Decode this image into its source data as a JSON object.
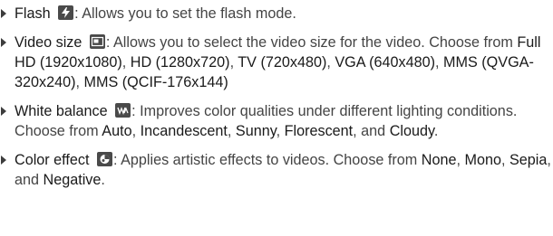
{
  "items": [
    {
      "term": "Flash",
      "icon": "flash-bolt-icon",
      "sep": ":",
      "desc": " Allows you to set the flash mode."
    },
    {
      "term": "Video size",
      "icon": "video-size-icon",
      "sep": ":",
      "desc": " Allows you to select the video size for the video. Choose from ",
      "options": [
        "Full HD (1920x1080)",
        "HD (1280x720)",
        "TV (720x480)",
        "VGA (640x480)",
        "MMS (QVGA-320x240)",
        "MMS (QCIF-176x144)"
      ]
    },
    {
      "term": "White balance",
      "icon": "white-balance-icon",
      "sep": ":",
      "desc": " Improves color qualities under different lighting conditions. Choose from ",
      "options": [
        "Auto",
        "Incandescent",
        "Sunny",
        "Florescent",
        "Cloudy"
      ],
      "end": "."
    },
    {
      "term": "Color effect",
      "icon": "color-effect-icon",
      "sep": ":",
      "desc": " Applies artistic effects to videos. Choose from ",
      "options": [
        "None",
        "Mono",
        "Sepia",
        "Negative"
      ],
      "end": "."
    }
  ],
  "connectors": {
    "comma": ", ",
    "and_last": ", and ",
    "and": "and "
  },
  "colors": {
    "icon_bg": "#4a4a4a",
    "bullet": "#3d3d3d"
  }
}
